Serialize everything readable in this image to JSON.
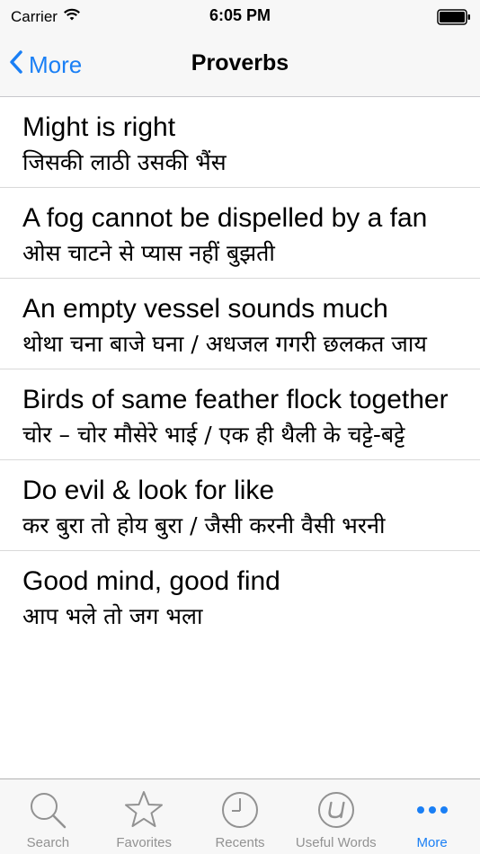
{
  "status_bar": {
    "carrier": "Carrier",
    "time": "6:05 PM"
  },
  "nav": {
    "back_label": "More",
    "title": "Proverbs"
  },
  "proverbs": [
    {
      "english": "Might is right",
      "hindi": "जिसकी लाठी उसकी भैंस"
    },
    {
      "english": "A fog cannot be dispelled by a fan",
      "hindi": "ओस चाटने से प्यास नहीं बुझती"
    },
    {
      "english": "An empty vessel sounds much",
      "hindi": "थोथा चना बाजे घना / अधजल गगरी छलकत जाय"
    },
    {
      "english": "Birds of same feather flock together",
      "hindi": "चोर – चोर मौसेरे भाई / एक ही थैली के चट्टे-बट्टे"
    },
    {
      "english": "Do evil & look for like",
      "hindi": "कर बुरा तो होय बुरा / जैसी करनी वैसी भरनी"
    },
    {
      "english": "Good mind, good find",
      "hindi": "आप भले तो जग भला"
    }
  ],
  "tabs": [
    {
      "label": "Search",
      "icon": "search-icon"
    },
    {
      "label": "Favorites",
      "icon": "star-icon"
    },
    {
      "label": "Recents",
      "icon": "clock-icon"
    },
    {
      "label": "Useful Words",
      "icon": "u-circle-icon"
    },
    {
      "label": "More",
      "icon": "more-dots-icon"
    }
  ],
  "colors": {
    "accent": "#1a7ff5",
    "inactive": "#929292",
    "bar_background": "#f7f7f7"
  }
}
